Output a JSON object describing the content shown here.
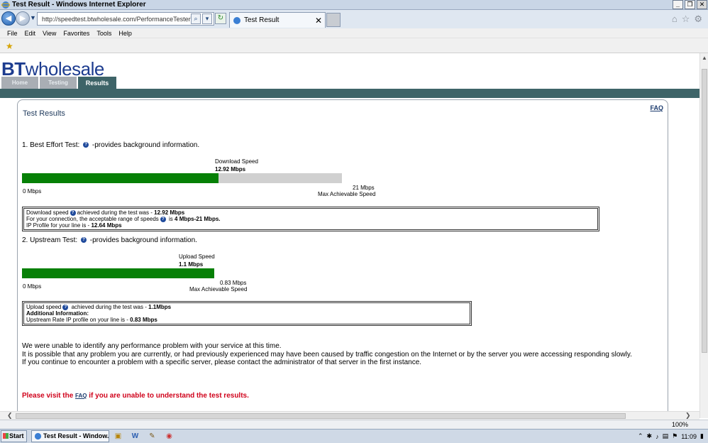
{
  "window": {
    "title": "Test Result - Windows Internet Explorer"
  },
  "browser": {
    "url": "http://speedtest.btwholesale.com/PerformanceTesterWS/diag",
    "tab_title": "Test Result",
    "menu": [
      "File",
      "Edit",
      "View",
      "Favorites",
      "Tools",
      "Help"
    ],
    "zoom": "100%"
  },
  "site": {
    "logo_bold": "BT",
    "logo_rest": "wholesale",
    "tabs": [
      "Home",
      "Testing",
      "Results"
    ],
    "active_tab": "Results"
  },
  "results": {
    "title": "Test Results",
    "faq": "FAQ",
    "best_effort": {
      "heading_prefix": "1. Best Effort Test:",
      "heading_suffix": "-provides background information.",
      "gauge_title": "Download  Speed",
      "gauge_value": "12.92 Mbps",
      "measured": 12.92,
      "max": 21,
      "min_label": "0 Mbps",
      "max_label": "21 Mbps",
      "max_caption": "Max Achievable Speed",
      "box_line1_prefix": "Download speed",
      "box_line1_mid": "achieved during the test was -",
      "box_line1_value": "12.92 Mbps",
      "box_line2_prefix": "For your connection, the acceptable range of speeds",
      "box_line2_mid": "is",
      "box_line2_value": "4 Mbps-21 Mbps.",
      "box_line3_prefix": "IP Profile for your line is -",
      "box_line3_value": "12.64 Mbps"
    },
    "upstream": {
      "heading_prefix": "2. Upstream Test:",
      "heading_suffix": "-provides background information.",
      "gauge_title": "Upload Speed",
      "gauge_value": "1.1 Mbps",
      "measured": 1.1,
      "max": 0.83,
      "min_label": "0 Mbps",
      "max_label": "0.83 Mbps",
      "max_caption": "Max Achievable Speed",
      "box_line1_prefix": "Upload speed",
      "box_line1_mid": "achieved during the test was -",
      "box_line1_value": "1.1Mbps",
      "box_line2": "Additional Information:",
      "box_line3_prefix": "Upstream Rate IP profile on your line is -",
      "box_line3_value": "0.83 Mbps"
    },
    "summary": [
      "We were unable to identify any performance problem with your service at this time.",
      "It is possible that any problem you are currently, or had previously experienced may have been caused by traffic congestion on the Internet or by the server you were accessing responding slowly.",
      "If you continue to encounter a problem with a specific server, please contact the administrator of that server in the first instance."
    ],
    "visit_prefix": "Please visit the",
    "visit_link": "FAQ",
    "visit_suffix": "if you are unable to understand the test results."
  },
  "taskbar": {
    "start": "Start",
    "task_item": "Test Result - Window...",
    "clock": "11:09"
  },
  "colors": {
    "bar_fill": "#068006",
    "bar_track": "#d0d0d0",
    "teal": "#3e6468",
    "brand": "#1d3c8f",
    "warning": "#d0021b"
  }
}
